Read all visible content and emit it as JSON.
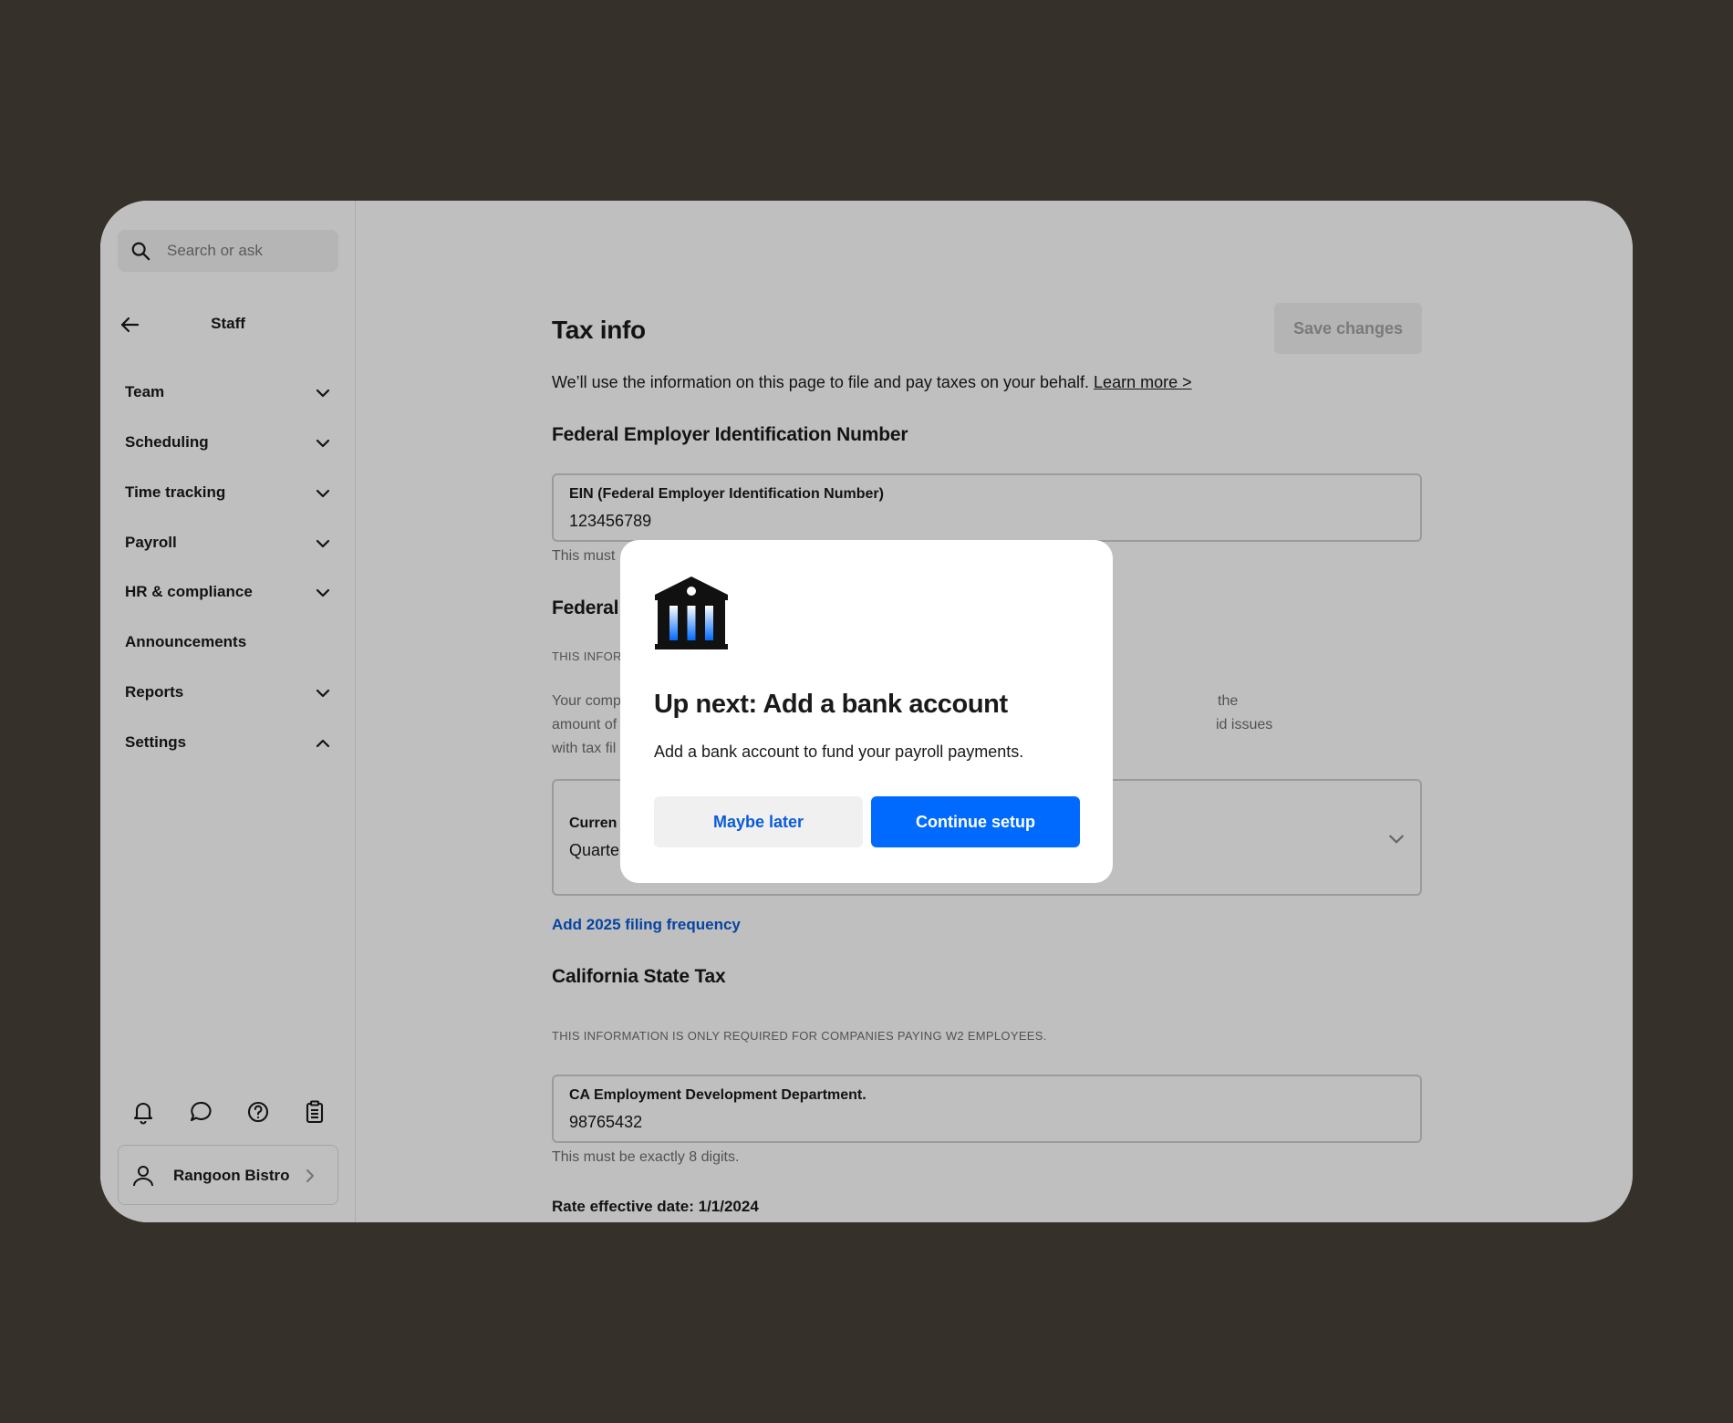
{
  "search": {
    "placeholder": "Search or ask"
  },
  "sidebar": {
    "title": "Staff",
    "items": [
      {
        "label": "Team",
        "chevron": "down"
      },
      {
        "label": "Scheduling",
        "chevron": "down"
      },
      {
        "label": "Time tracking",
        "chevron": "down"
      },
      {
        "label": "Payroll",
        "chevron": "down"
      },
      {
        "label": "HR & compliance",
        "chevron": "down"
      },
      {
        "label": "Announcements",
        "chevron": "none"
      },
      {
        "label": "Reports",
        "chevron": "down"
      },
      {
        "label": "Settings",
        "chevron": "up"
      }
    ],
    "footer_icons": [
      "bell-icon",
      "chat-icon",
      "help-icon",
      "clipboard-icon"
    ],
    "account": {
      "name": "Rangoon Bistro"
    }
  },
  "main": {
    "title": "Tax info",
    "save_label": "Save changes",
    "intro": "We’ll use the information on this page to file and pay taxes on your behalf.",
    "learn_more": "Learn more >",
    "federal_ein": {
      "heading": "Federal Employer Identification Number",
      "field_label": "EIN (Federal Employer Identification Number)",
      "field_value": "123456789",
      "hint_partial": "This must"
    },
    "federal_filing": {
      "heading_partial": "Federal",
      "caps_partial": "THIS INFOR",
      "para_left": [
        "Your comp",
        "amount of",
        "with tax fil"
      ],
      "para_right": [
        "the",
        "id issues"
      ],
      "field_label_partial": "Curren",
      "field_value_partial": "Quarte",
      "add_link": "Add 2025 filing frequency"
    },
    "california": {
      "heading": "California State Tax",
      "caps": "THIS INFORMATION IS ONLY REQUIRED FOR COMPANIES PAYING W2 EMPLOYEES.",
      "field_label": "CA Employment Development Department.",
      "field_value": "98765432",
      "hint": "This must be exactly 8 digits.",
      "rate_date": "Rate effective date: 1/1/2024"
    }
  },
  "modal": {
    "icon": "bank-icon",
    "title": "Up next: Add a bank account",
    "text": "Add a bank account to fund your payroll payments.",
    "secondary_label": "Maybe later",
    "primary_label": "Continue setup",
    "primary_color": "#006aff"
  }
}
